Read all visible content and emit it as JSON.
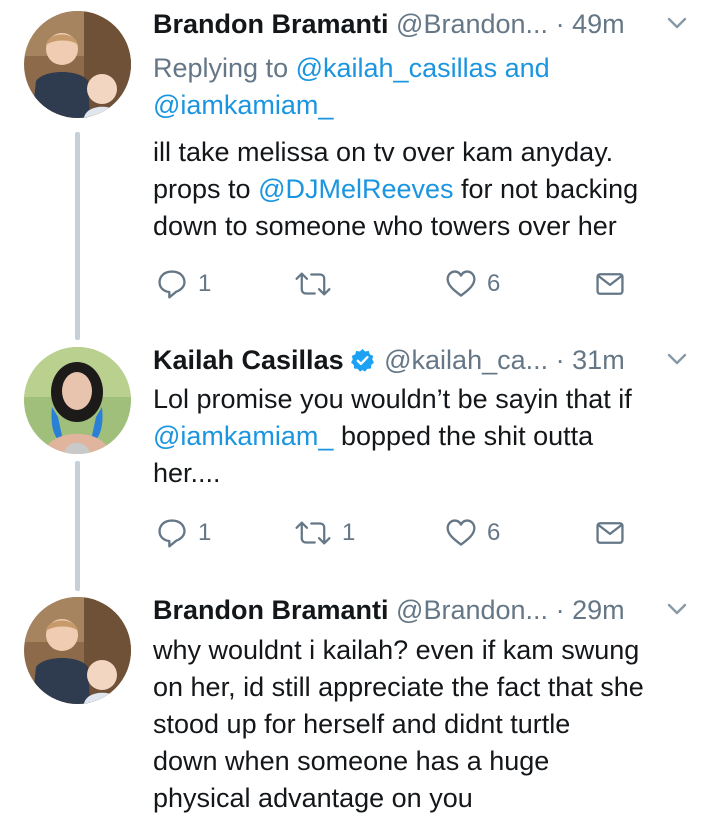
{
  "tweets": [
    {
      "name": "Brandon Bramanti",
      "handle": "@Brandon...",
      "dot": "·",
      "time": "49m",
      "replying_prefix": "Replying to ",
      "replying_user1": "@kailah_casillas",
      "replying_and": " and",
      "replying_user2": "@iamkamiam_",
      "text_1": "ill take melissa on tv over kam anyday.",
      "text_2_pre": "props to ",
      "mention": "@DJMelReeves",
      "text_2_post": " for not backing",
      "text_3": "down to someone who towers over her",
      "reply_count": "1",
      "retweet_count": "",
      "like_count": "6"
    },
    {
      "name": "Kailah Casillas",
      "verified": true,
      "handle": "@kailah_ca...",
      "dot": "·",
      "time": "31m",
      "text_1": "Lol promise you wouldn’t be sayin that if",
      "mention": "@iamkamiam_",
      "text_2_post": " bopped the shit outta",
      "text_3": "her....",
      "reply_count": "1",
      "retweet_count": "1",
      "like_count": "6"
    },
    {
      "name": "Brandon Bramanti",
      "handle": "@Brandon...",
      "dot": "·",
      "time": "29m",
      "lines": [
        "why wouldnt i kailah? even if kam swung",
        "on her, id still appreciate the fact that she",
        "stood up for herself and didnt turtle",
        "down when someone has a huge",
        "physical advantage on you"
      ]
    }
  ],
  "colors": {
    "link": "#1b95e0",
    "muted": "#657786",
    "thread_line": "#c7d0d6",
    "verified": "#1da1f2"
  },
  "icons": [
    "reply-icon",
    "retweet-icon",
    "like-icon",
    "dm-icon",
    "chevron-down-icon",
    "verified-icon"
  ]
}
